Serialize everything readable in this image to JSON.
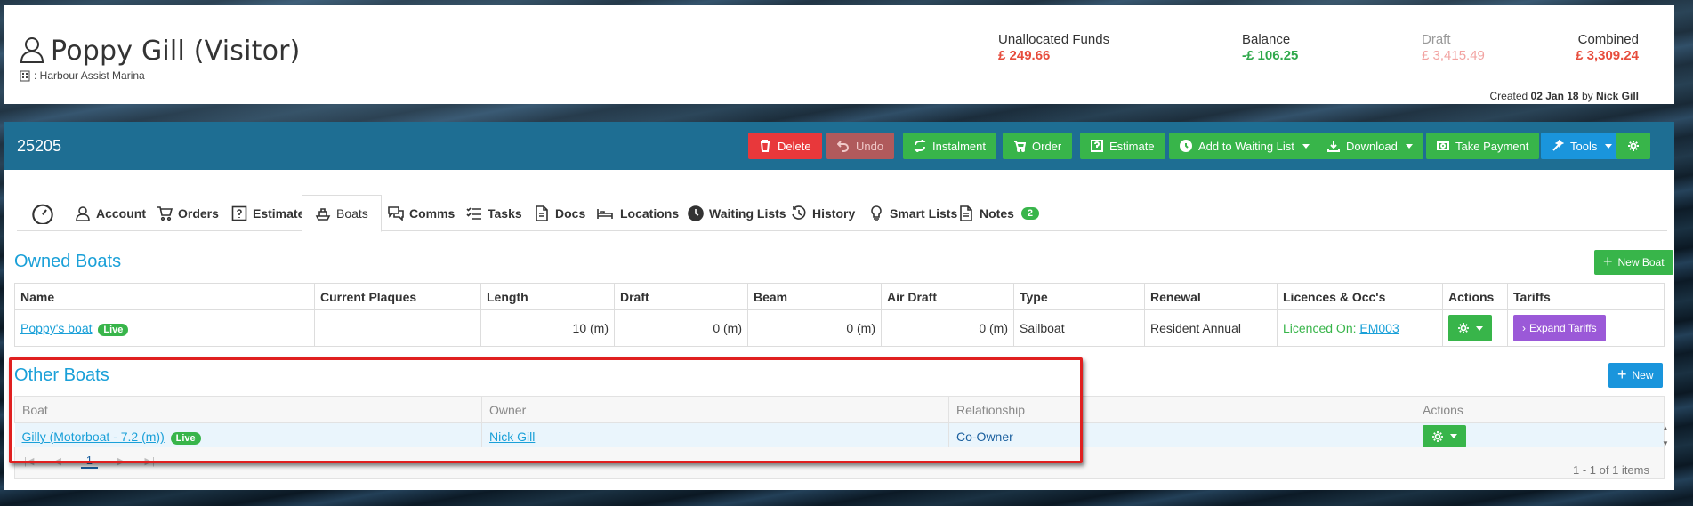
{
  "header": {
    "person_name": "Poppy Gill (Visitor)",
    "marina": ": Harbour Assist Marina",
    "funds": {
      "unallocated_label": "Unallocated Funds",
      "unallocated_value": "£ 249.66",
      "balance_label": "Balance",
      "balance_value": "-£ 106.25",
      "draft_label": "Draft",
      "draft_value": "£ 3,415.49",
      "combined_label": "Combined",
      "combined_value": "£ 3,309.24"
    },
    "created_prefix": "Created",
    "created_date": "02 Jan 18",
    "created_by_word": "by",
    "created_by": "Nick Gill"
  },
  "toolbar": {
    "account_number": "25205",
    "delete": "Delete",
    "undo": "Undo",
    "instalment": "Instalment",
    "order": "Order",
    "estimate": "Estimate",
    "waiting_list": "Add to Waiting List",
    "download": "Download",
    "take_payment": "Take Payment",
    "tools": "Tools"
  },
  "tabs": {
    "account": "Account",
    "orders": "Orders",
    "estimates": "Estimates",
    "boats": "Boats",
    "comms": "Comms",
    "tasks": "Tasks",
    "docs": "Docs",
    "locations": "Locations",
    "waiting_lists": "Waiting Lists",
    "history": "History",
    "smart_lists": "Smart Lists",
    "notes": "Notes",
    "notes_count": "2"
  },
  "owned_boats": {
    "title": "Owned Boats",
    "new_button": "New Boat",
    "headers": {
      "name": "Name",
      "plaques": "Current Plaques",
      "length": "Length",
      "draft": "Draft",
      "beam": "Beam",
      "air_draft": "Air Draft",
      "type": "Type",
      "renewal": "Renewal",
      "licences": "Licences & Occ's",
      "actions": "Actions",
      "tariffs": "Tariffs"
    },
    "row": {
      "name": "Poppy's boat",
      "status": "Live",
      "plaques": "",
      "length": "10 (m)",
      "draft": "0 (m)",
      "beam": "0 (m)",
      "air_draft": "0 (m)",
      "type": "Sailboat",
      "renewal": "Resident Annual",
      "licence_prefix": "Licenced On:",
      "licence_code": "EM003",
      "expand_tariffs": "Expand Tariffs"
    }
  },
  "other_boats": {
    "title": "Other Boats",
    "new_button": "New",
    "headers": {
      "boat": "Boat",
      "owner": "Owner",
      "relationship": "Relationship",
      "actions": "Actions"
    },
    "row": {
      "boat": "Gilly (Motorboat - 7.2 (m))",
      "status": "Live",
      "owner": "Nick Gill",
      "relationship": "Co-Owner"
    },
    "pager": {
      "current_page": "1",
      "summary": "1 - 1 of 1 items"
    }
  }
}
